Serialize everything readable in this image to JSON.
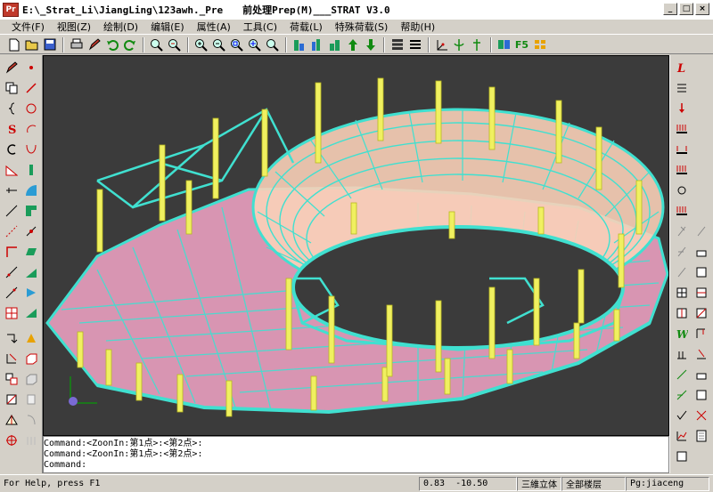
{
  "window": {
    "title_path": "E:\\_Strat_Li\\JiangLing\\123awh._Pre",
    "title_app": "前处理Prep(M)___STRAT V3.0",
    "app_icon_text": "Pr",
    "min_glyph": "_",
    "max_glyph": "□",
    "close_glyph": "×"
  },
  "menu": [
    "文件(F)",
    "视图(Z)",
    "绘制(D)",
    "编辑(E)",
    "属性(A)",
    "工具(C)",
    "荷载(L)",
    "特殊荷载(S)",
    "帮助(H)"
  ],
  "toolbar": {
    "f5_label": "F5",
    "icons": [
      "new-icon",
      "open-icon",
      "save-icon",
      "print-icon",
      "edit-icon",
      "undo-icon",
      "redo-icon",
      "zoom-window-icon",
      "zoom-previous-icon",
      "zoom-in-icon",
      "zoom-out-icon",
      "zoom-extents-icon",
      "pan-icon",
      "rotate-icon",
      "view-front-icon",
      "view-side-icon",
      "move-up-icon",
      "move-down-icon",
      "layers-icon",
      "stack-icon",
      "coordinate-icon",
      "axis-icon",
      "support-icon",
      "book-icon",
      "f5-refresh",
      "grid-icon"
    ]
  },
  "left_toolbar": {
    "icons": [
      "pencil-icon",
      "point-icon",
      "copy-icon",
      "line-icon",
      "brace-icon",
      "circle-icon",
      "s-curve-icon",
      "arc-icon",
      "c-curve-icon",
      "u-curve-icon",
      "area-icon",
      "column-icon",
      "beam-line-icon",
      "quarter-circle-icon",
      "slash-line-icon",
      "shape-icon",
      "dashed-line-icon",
      "node-icon",
      "corner-icon",
      "parallelogram-icon",
      "diagonal-icon",
      "wedge-icon",
      "rect-icon",
      "arrow-icon",
      "grid-icon",
      "triangle-icon",
      "rotate-icon",
      "wall-icon",
      "offset-icon",
      "cube-icon",
      "copy-array-icon",
      "block-icon",
      "mirror-icon",
      "dim-icon",
      "measure-icon",
      "target-icon",
      "hatch-icon"
    ]
  },
  "right_toolbar": {
    "icons": [
      "load-l-icon",
      "numbered-list-icon",
      "vertical-load-icon",
      "bar-load-icon",
      "line-load-icon",
      "bar-load-2-icon",
      "moment-icon",
      "distributed-load-icon",
      "temperature-icon",
      "wind-load-icon",
      "point-load-icon",
      "seismic-icon",
      "support-load-icon",
      "node-load-icon",
      "hinge-icon",
      "member-load-icon",
      "combination-icon",
      "envelope-icon",
      "w-load-icon",
      "crane-icon",
      "moving-load-icon",
      "shell-load-icon",
      "pressure-icon",
      "snow-icon",
      "settle-icon",
      "prestress-icon",
      "check-icon",
      "delete-load-icon",
      "result-icon",
      "report-icon"
    ]
  },
  "command": {
    "lines": [
      "Command:<ZoonIn:第1点>:<第2点>:",
      "Command:<ZoonIn:第1点>:<第2点>:",
      "Command:"
    ]
  },
  "status": {
    "help": "For Help, press F1",
    "x": "0.83",
    "y": "-10.50",
    "view_mode": "三維立体",
    "floor": "全部楼层",
    "page": "Pg:jiaceng"
  },
  "colors": {
    "background": "#3b3b3b",
    "beams": "#40e0d0",
    "slabs": "#f4a6c8",
    "columns": "#f0f060"
  }
}
